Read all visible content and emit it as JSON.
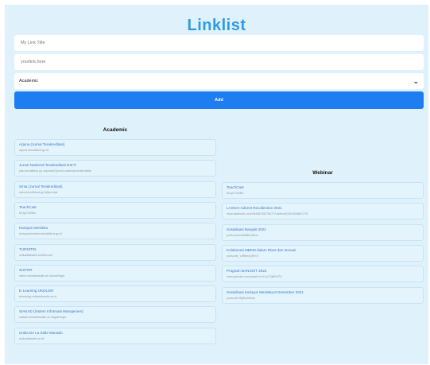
{
  "header": {
    "title": "Linklist"
  },
  "form": {
    "title_placeholder": "My Link Title",
    "url_placeholder": "yourlink.here",
    "category_selected": "Academic",
    "add_label": "Add"
  },
  "icons": {
    "dropdown": "chevron-down-icon"
  },
  "colors": {
    "title": "#2e9be6",
    "button": "#1e7df0",
    "background": "#dff2fc",
    "link": "#3a78c9"
  },
  "academic": {
    "heading": "Academic",
    "links": [
      {
        "title": "Arjuna (Jurnal Terakreditasi)",
        "url": "arjuna.kemdikbud.go.id"
      },
      {
        "title": "Jurnal Nasional Terakreditasi DIKTI",
        "url": "pak.kemdikbud.go.id/portal/2/jurnal-nasional-terakreditasi"
      },
      {
        "title": "Sinta (Jurnal Terakreditasi)",
        "url": "www.kemdikbud.go.id/journals"
      },
      {
        "title": "TeachCast",
        "url": "bit.ly/3 fAhNn"
      },
      {
        "title": "Kampus Merdeka",
        "url": "kampusmerdeka.kemdikbud.go.id"
      },
      {
        "title": "TURNITIN",
        "url": "unikadelasalle.turnitin.com"
      },
      {
        "title": "SISTER",
        "url": "sister.unikadelasalle.ac.id/auth/login"
      },
      {
        "title": "E-Learning UKDLSM",
        "url": "elearning.unikadelasalle.ac.id"
      },
      {
        "title": "SIAKAD (Sistem Informasi Manajemen)",
        "url": "siakad.unikadelasalle.ac.id/gate/login"
      },
      {
        "title": "Unika De La Salle Manado",
        "url": "unikadelasalle.ac.id"
      }
    ]
  },
  "webinar": {
    "heading": "Webinar",
    "links": [
      {
        "title": "TeachCast",
        "url": "bit.ly/3 fAhNn"
      },
      {
        "title": "LASSAI-Advent Recollection 2021",
        "url": "www.facebook.com/284487452783737/videos/91567626801779"
      },
      {
        "title": "Sosialisasi Bangkit 2022",
        "url": "youtu.be/smMH8hL8kew"
      },
      {
        "title": "Kolaborasi MBKM dalam Riset dan Inovasi",
        "url": "youtu.be/_vdRbmlQRm7I"
      },
      {
        "title": "Program BANGKIT 2022",
        "url": "www.youtube.com/watch?v=KLIrC7jMDdTU"
      },
      {
        "title": "Sosialisasi Kampus Merdeka,8 Desember 2021",
        "url": "youtu.be/J9jvBoIHAxw"
      }
    ]
  }
}
